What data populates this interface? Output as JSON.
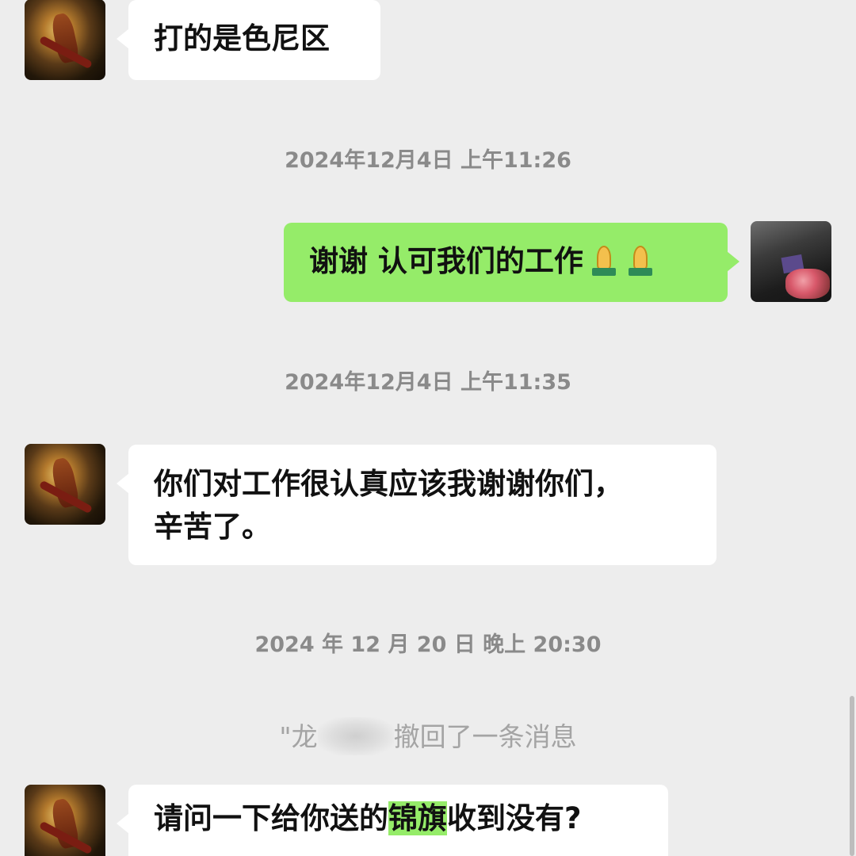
{
  "chat": {
    "messages": [
      {
        "id": "m1",
        "side": "left",
        "text": "打的是色尼区"
      },
      {
        "id": "ts1",
        "type": "timestamp",
        "text": "2024年12月4日 上午11:26"
      },
      {
        "id": "m2",
        "side": "right",
        "text": "谢谢 认可我们的工作",
        "emoji": [
          "pray",
          "pray"
        ]
      },
      {
        "id": "ts2",
        "type": "timestamp",
        "text": "2024年12月4日 上午11:35"
      },
      {
        "id": "m3",
        "side": "left",
        "text_line1": "你们对工作很认真应该我谢谢你们，",
        "text_line2": "辛苦了。"
      },
      {
        "id": "ts3",
        "type": "timestamp",
        "text": "2024 年 12 月 20 日 晚上 20:30"
      },
      {
        "id": "sys1",
        "type": "system",
        "name_prefix": "\"龙",
        "text": "撤回了一条消息"
      },
      {
        "id": "m4",
        "side": "left",
        "text_before": "请问一下给你送的",
        "text_highlight": "锦旗",
        "text_after": "收到没有?"
      }
    ]
  },
  "colors": {
    "background": "#ededed",
    "incoming_bubble": "#ffffff",
    "outgoing_bubble": "#95ec69",
    "timestamp_text": "#8a8a8a",
    "system_text": "#a4a4a4",
    "highlight": "#95ec69"
  }
}
